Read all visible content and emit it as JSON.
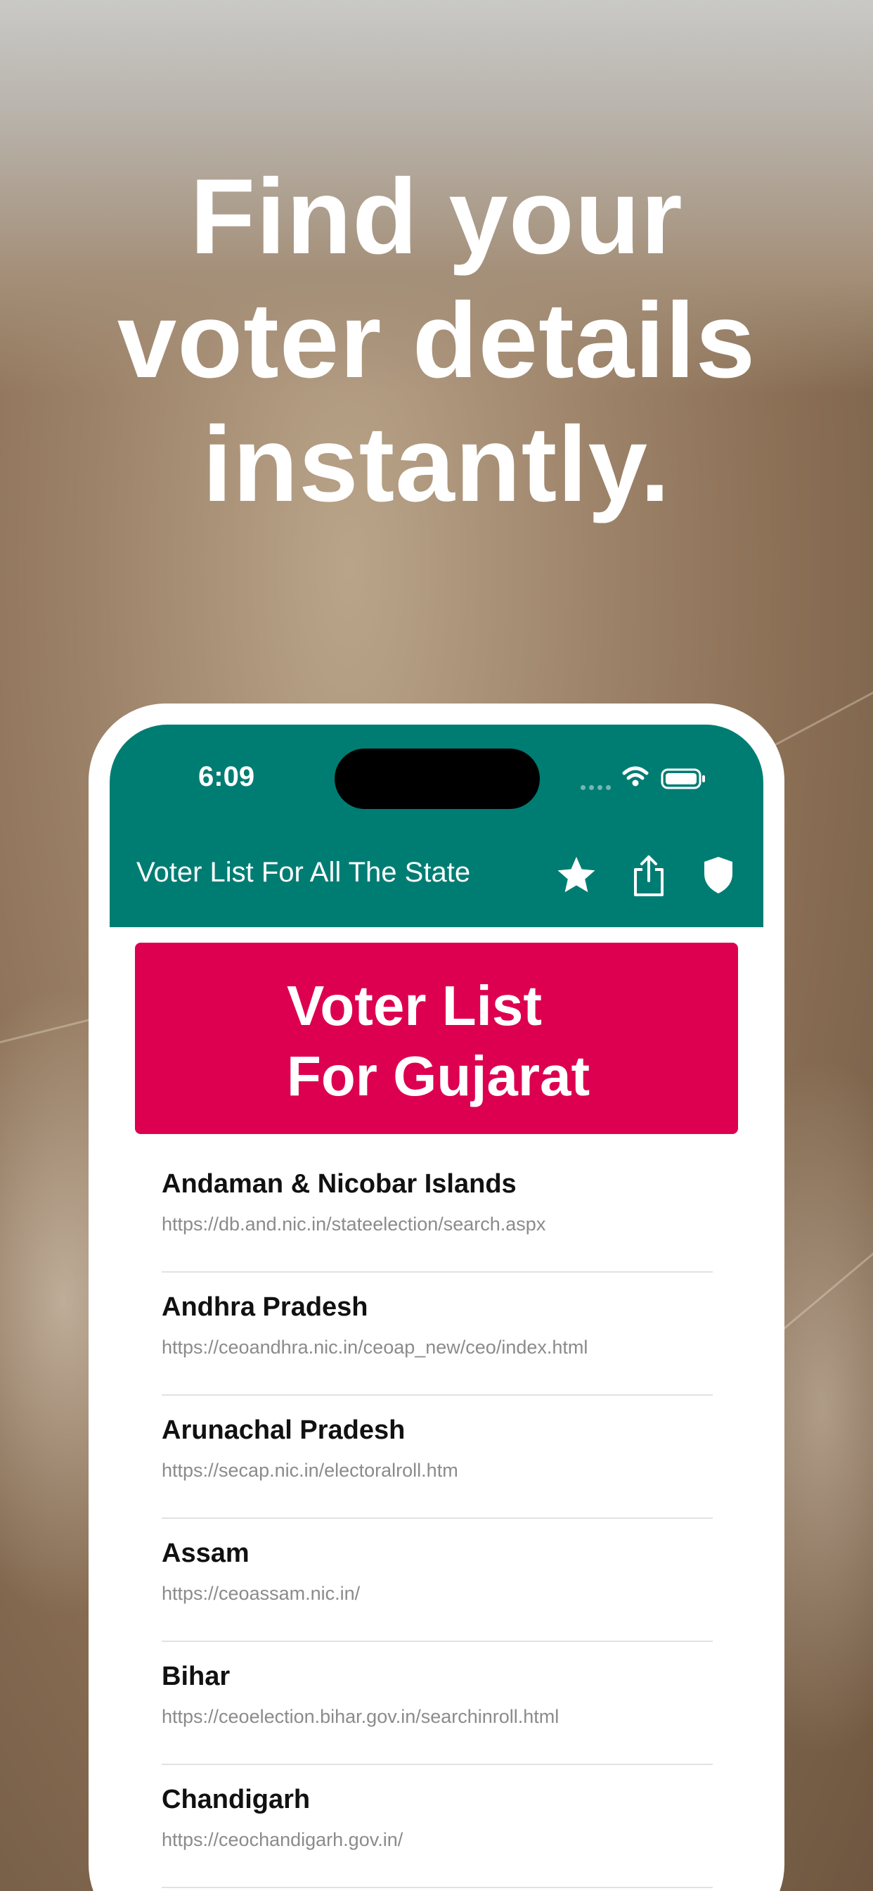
{
  "headline": {
    "lines": [
      "Find your",
      "voter details",
      "instantly."
    ]
  },
  "status_bar": {
    "time": "6:09"
  },
  "app_bar": {
    "title": "Voter List For All The State",
    "background_color": "#007d73",
    "icons": [
      "star-icon",
      "share-icon",
      "shield-icon"
    ]
  },
  "banner": {
    "line1": "Voter List",
    "line2": "For Gujarat",
    "background_color": "#dd0050"
  },
  "states": [
    {
      "name": "Andaman & Nicobar Islands",
      "url": "https://db.and.nic.in/stateelection/search.aspx"
    },
    {
      "name": "Andhra Pradesh",
      "url": "https://ceoandhra.nic.in/ceoap_new/ceo/index.html"
    },
    {
      "name": "Arunachal Pradesh",
      "url": "https://secap.nic.in/electoralroll.htm"
    },
    {
      "name": "Assam",
      "url": "https://ceoassam.nic.in/"
    },
    {
      "name": "Bihar",
      "url": "https://ceoelection.bihar.gov.in/searchinroll.html"
    },
    {
      "name": "Chandigarh",
      "url": "https://ceochandigarh.gov.in/"
    }
  ]
}
